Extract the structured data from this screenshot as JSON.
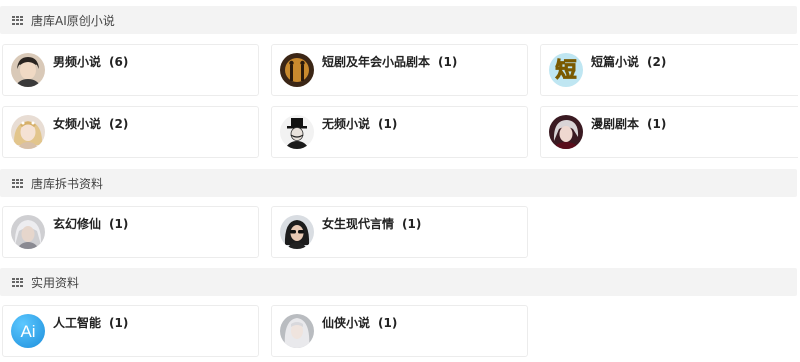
{
  "sections": [
    {
      "title": "唐库AI原创小说",
      "items": [
        {
          "label": "男频小说",
          "count": "(6)",
          "icon": "male-novel-avatar"
        },
        {
          "label": "短剧及年会小品剧本",
          "count": "(1)",
          "icon": "short-drama-avatar"
        },
        {
          "label": "短篇小说",
          "count": "(2)",
          "icon": "short-story-avatar",
          "badge": "短"
        },
        {
          "label": "女频小说",
          "count": "(2)",
          "icon": "female-novel-avatar"
        },
        {
          "label": "无频小说",
          "count": "(1)",
          "icon": "general-novel-avatar"
        },
        {
          "label": "漫剧剧本",
          "count": "(1)",
          "icon": "comic-drama-avatar"
        }
      ]
    },
    {
      "title": "唐库拆书资料",
      "items": [
        {
          "label": "玄幻修仙",
          "count": "(1)",
          "icon": "fantasy-cultivation-avatar"
        },
        {
          "label": "女生现代言情",
          "count": "(1)",
          "icon": "modern-romance-avatar"
        }
      ]
    },
    {
      "title": "实用资料",
      "items": [
        {
          "label": "人工智能",
          "count": "(1)",
          "icon": "ai-logo",
          "badge": "Ai"
        },
        {
          "label": "仙侠小说",
          "count": "(1)",
          "icon": "xianxia-novel-avatar"
        }
      ]
    }
  ],
  "colors": {
    "header_bg": "#f3f3f3",
    "card_border": "#ececec",
    "ai_blue": "#1ea0e6",
    "short_badge_bg": "#bfe6f2",
    "short_badge_fg": "#f2c21b"
  }
}
